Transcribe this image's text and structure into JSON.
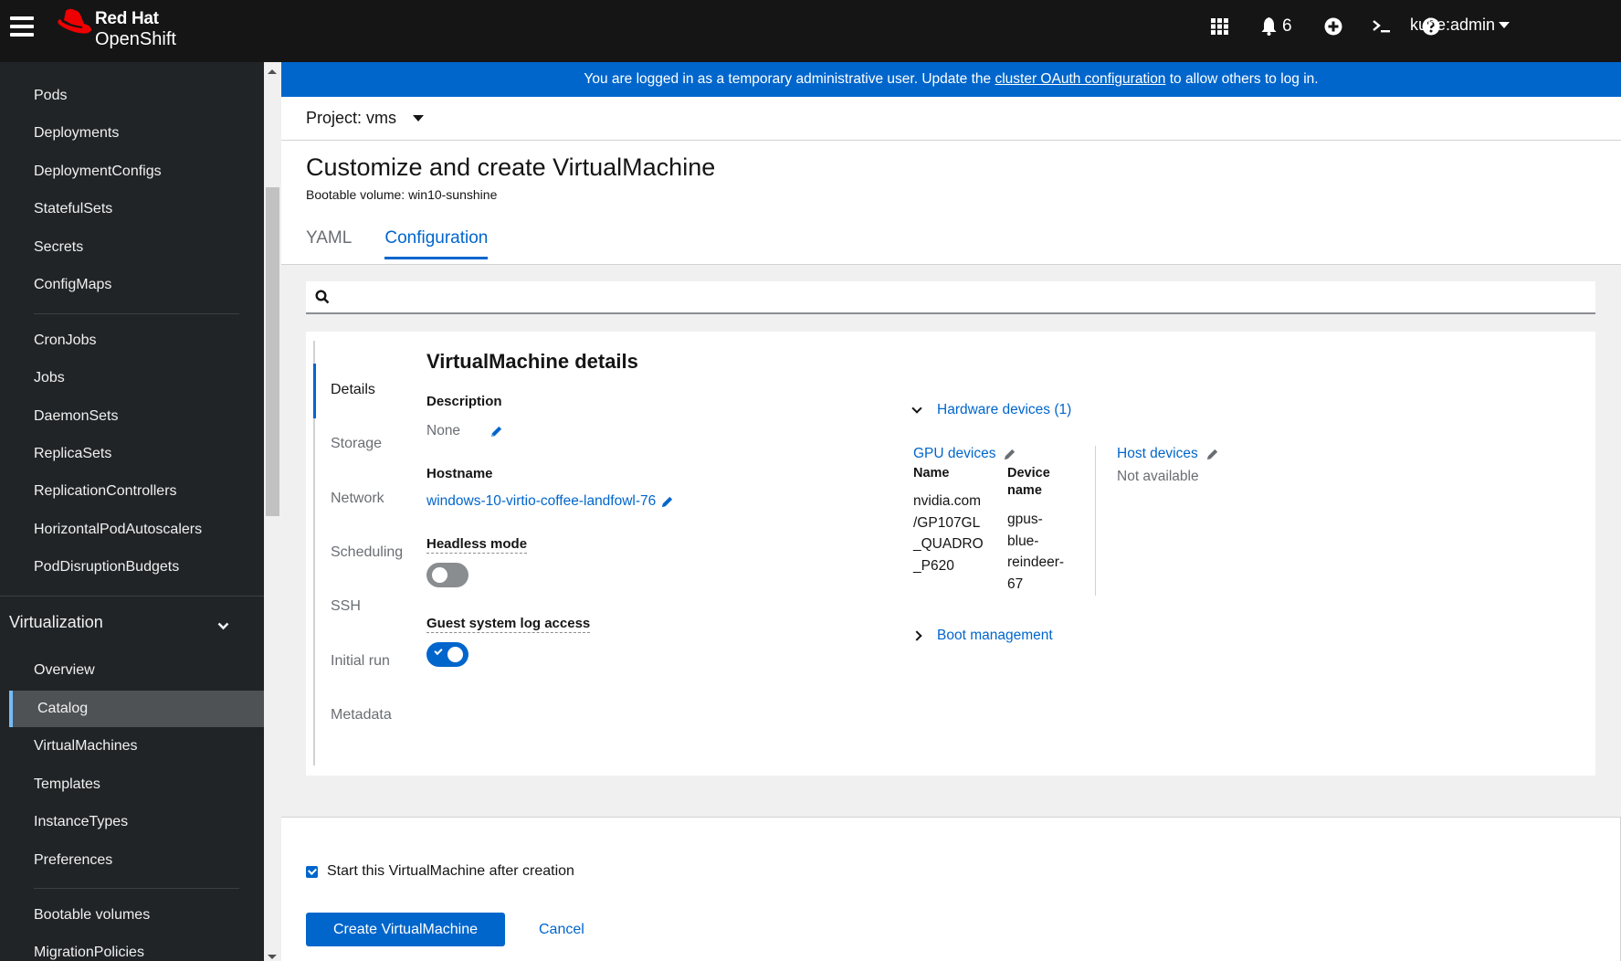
{
  "masthead": {
    "brand_line1": "Red Hat",
    "brand_line2": "OpenShift",
    "notifications_count": "6",
    "user": "kube:admin",
    "icons": [
      "hamburger-menu-icon",
      "app-launcher-grid-icon",
      "bell-icon",
      "plus-circle-icon",
      "terminal-icon",
      "question-circle-icon"
    ]
  },
  "sidebar": {
    "items_top": [
      {
        "label": "Pods"
      },
      {
        "label": "Deployments"
      },
      {
        "label": "DeploymentConfigs"
      },
      {
        "label": "StatefulSets"
      },
      {
        "label": "Secrets"
      },
      {
        "label": "ConfigMaps"
      },
      {
        "label": "CronJobs"
      },
      {
        "label": "Jobs"
      },
      {
        "label": "DaemonSets"
      },
      {
        "label": "ReplicaSets"
      },
      {
        "label": "ReplicationControllers"
      },
      {
        "label": "HorizontalPodAutoscalers"
      },
      {
        "label": "PodDisruptionBudgets"
      }
    ],
    "group_label": "Virtualization",
    "group_items": [
      {
        "label": "Overview"
      },
      {
        "label": "Catalog",
        "active": true
      },
      {
        "label": "VirtualMachines"
      },
      {
        "label": "Templates"
      },
      {
        "label": "InstanceTypes"
      },
      {
        "label": "Preferences"
      },
      {
        "label": "Bootable volumes"
      },
      {
        "label": "MigrationPolicies"
      }
    ]
  },
  "banner": {
    "text_before": "You are logged in as a temporary administrative user. Update the ",
    "link": "cluster OAuth configuration",
    "text_after": " to allow others to log in.",
    "color": "#0066cc"
  },
  "project": {
    "label": "Project: vms"
  },
  "page": {
    "title": "Customize and create VirtualMachine",
    "subtitle": "Bootable volume: win10-sunshine",
    "tabs": [
      {
        "label": "YAML",
        "active": false
      },
      {
        "label": "Configuration",
        "active": true
      }
    ],
    "search_placeholder": ""
  },
  "jumplinks": [
    {
      "label": "Details",
      "active": true
    },
    {
      "label": "Storage"
    },
    {
      "label": "Network"
    },
    {
      "label": "Scheduling"
    },
    {
      "label": "SSH"
    },
    {
      "label": "Initial run"
    },
    {
      "label": "Metadata"
    }
  ],
  "details": {
    "section_title": "VirtualMachine details",
    "description_label": "Description",
    "description_value": "None",
    "hostname_label": "Hostname",
    "hostname_value": "windows-10-virtio-coffee-landfowl-76",
    "headless_label": "Headless mode",
    "headless_on": false,
    "guest_log_label": "Guest system log access",
    "guest_log_on": true
  },
  "hardware": {
    "toggle_label": "Hardware devices (1)",
    "gpu_title": "GPU devices",
    "col_name": "Name",
    "col_device_line1": "Device",
    "col_device_line2": "name",
    "gpu_name_lines": [
      "nvidia.com",
      "/GP107GL",
      "_QUADRO",
      "_P620"
    ],
    "gpu_device_lines": [
      "gpus-",
      "blue-",
      "reindeer-",
      "67"
    ],
    "host_title": "Host devices",
    "host_value": "Not available",
    "boot_label": "Boot management"
  },
  "footer": {
    "start_checkbox_label": "Start this VirtualMachine after creation",
    "start_checked": true,
    "create_label": "Create VirtualMachine",
    "cancel_label": "Cancel"
  }
}
